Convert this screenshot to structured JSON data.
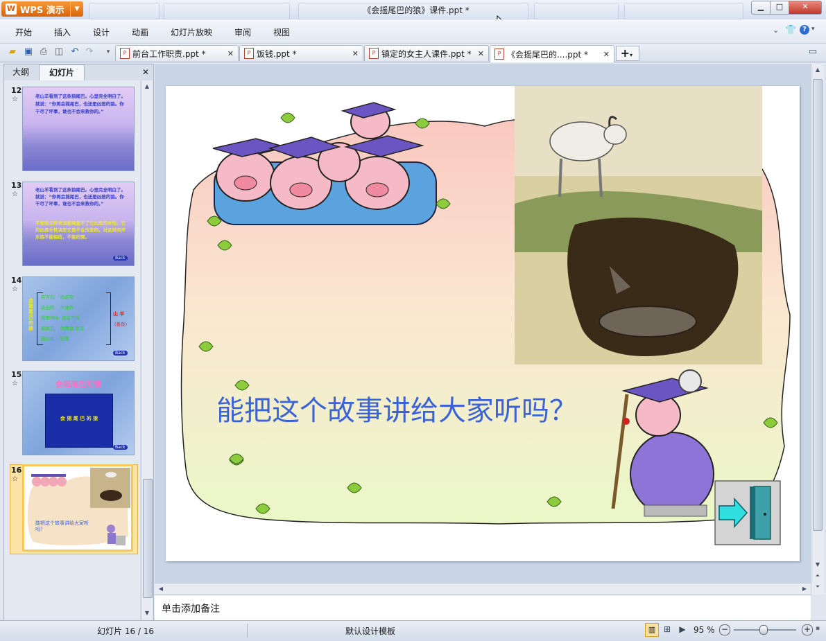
{
  "app": {
    "name": "WPS 演示",
    "window_title": "《会摇尾巴的狼》课件.ppt *"
  },
  "menu": [
    "开始",
    "插入",
    "设计",
    "动画",
    "幻灯片放映",
    "审阅",
    "视图"
  ],
  "doc_tabs": [
    {
      "label": "前台工作职责.ppt *"
    },
    {
      "label": "饭钱.ppt *"
    },
    {
      "label": "镇定的女主人课件.ppt *"
    },
    {
      "label": "《会摇尾巴的....ppt *"
    }
  ],
  "left_pane": {
    "tabs": [
      "大纲",
      "幻灯片"
    ],
    "slides": [
      {
        "number": "12"
      },
      {
        "number": "13"
      },
      {
        "number": "14"
      },
      {
        "number": "15"
      },
      {
        "number": "16"
      }
    ],
    "thumb_text": {
      "t12": "老山羊看到了这条狼尾巴。心里完全明白了。就说：“你再会摇尾巴，也还是凶恶的狼。你干尽了坏事，谁也不会来救你的。”",
      "t13_top": "老山羊看到了这条狼尾巴。心里完全明白了。就说：“你再会摇尾巴，也还是凶恶的狼。你干尽了坏事，谁也不会来救你的。”",
      "t13_bottom": "不管狼怎样表演都掩盖不了它凶恶的本性。它的凶恶本性决定它是不会改变的。对这样的坏东西不能相信，不能同情。",
      "t14_left": "会摇尾巴的狼",
      "t14_rows": [
        [
          "花言巧",
          "你这是"
        ],
        [
          "装出的",
          "不要的"
        ],
        [
          "我来帮你",
          "假装可怜"
        ],
        [
          "摇尾巴",
          "你再会",
          "也还"
        ],
        [
          "露凶相",
          "狡猾"
        ]
      ],
      "t14_right": "山 羊",
      "t14_right2": "（善良）",
      "t15_title": "会摇尾巴的狼",
      "t15_box": "会 摇 尾 巴 的 狼",
      "back": "Back",
      "t16": "能把这个故事讲给大家听吗？"
    }
  },
  "slide": {
    "text": "能把这个故事讲给大家听吗？"
  },
  "notes": {
    "placeholder": "单击添加备注"
  },
  "status": {
    "slide_counter": "幻灯片 16 / 16",
    "template": "默认设计模板",
    "zoom": "95 %"
  },
  "colors": {
    "accent_orange": "#e07010",
    "slide_text": "#3c63d6",
    "selected_thumb": "#f7c85a"
  }
}
